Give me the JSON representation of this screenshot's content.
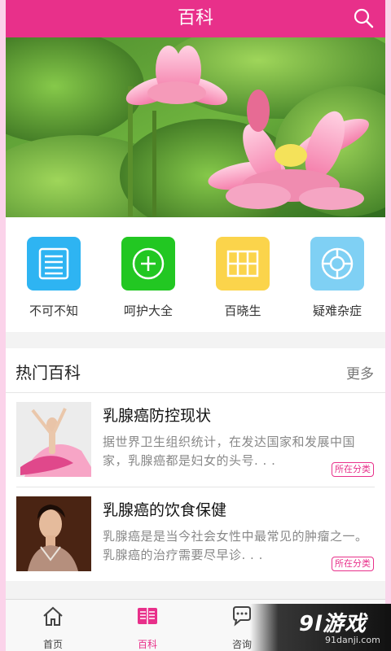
{
  "header": {
    "title": "百科"
  },
  "categories": [
    {
      "label": "不可不知",
      "color": "#2eb4f2",
      "icon": "list-icon"
    },
    {
      "label": "呵护大全",
      "color": "#22c722",
      "icon": "plus-circle-icon"
    },
    {
      "label": "百晓生",
      "color": "#fbd44b",
      "icon": "map-icon"
    },
    {
      "label": "疑难杂症",
      "color": "#7fd0f4",
      "icon": "lifebuoy-icon"
    }
  ],
  "hot": {
    "title": "热门百科",
    "more": "更多",
    "articles": [
      {
        "title": "乳腺癌防控现状",
        "desc": "据世界卫生组织统计，在发达国家和发展中国家，乳腺癌都是妇女的头号. . .",
        "tag": "所在分类"
      },
      {
        "title": "乳腺癌的饮食保健",
        "desc": "乳腺癌是是当今社会女性中最常见的肿瘤之一。乳腺癌的治疗需要尽早诊. . .",
        "tag": "所在分类"
      }
    ]
  },
  "tabs": [
    {
      "label": "首页",
      "icon": "home-icon",
      "active": false
    },
    {
      "label": "百科",
      "icon": "book-icon",
      "active": true
    },
    {
      "label": "咨询",
      "icon": "chat-icon",
      "active": false
    }
  ],
  "watermark": {
    "main": "9l游戏",
    "sub": "91danji.com"
  },
  "colors": {
    "accent": "#e8308a"
  }
}
